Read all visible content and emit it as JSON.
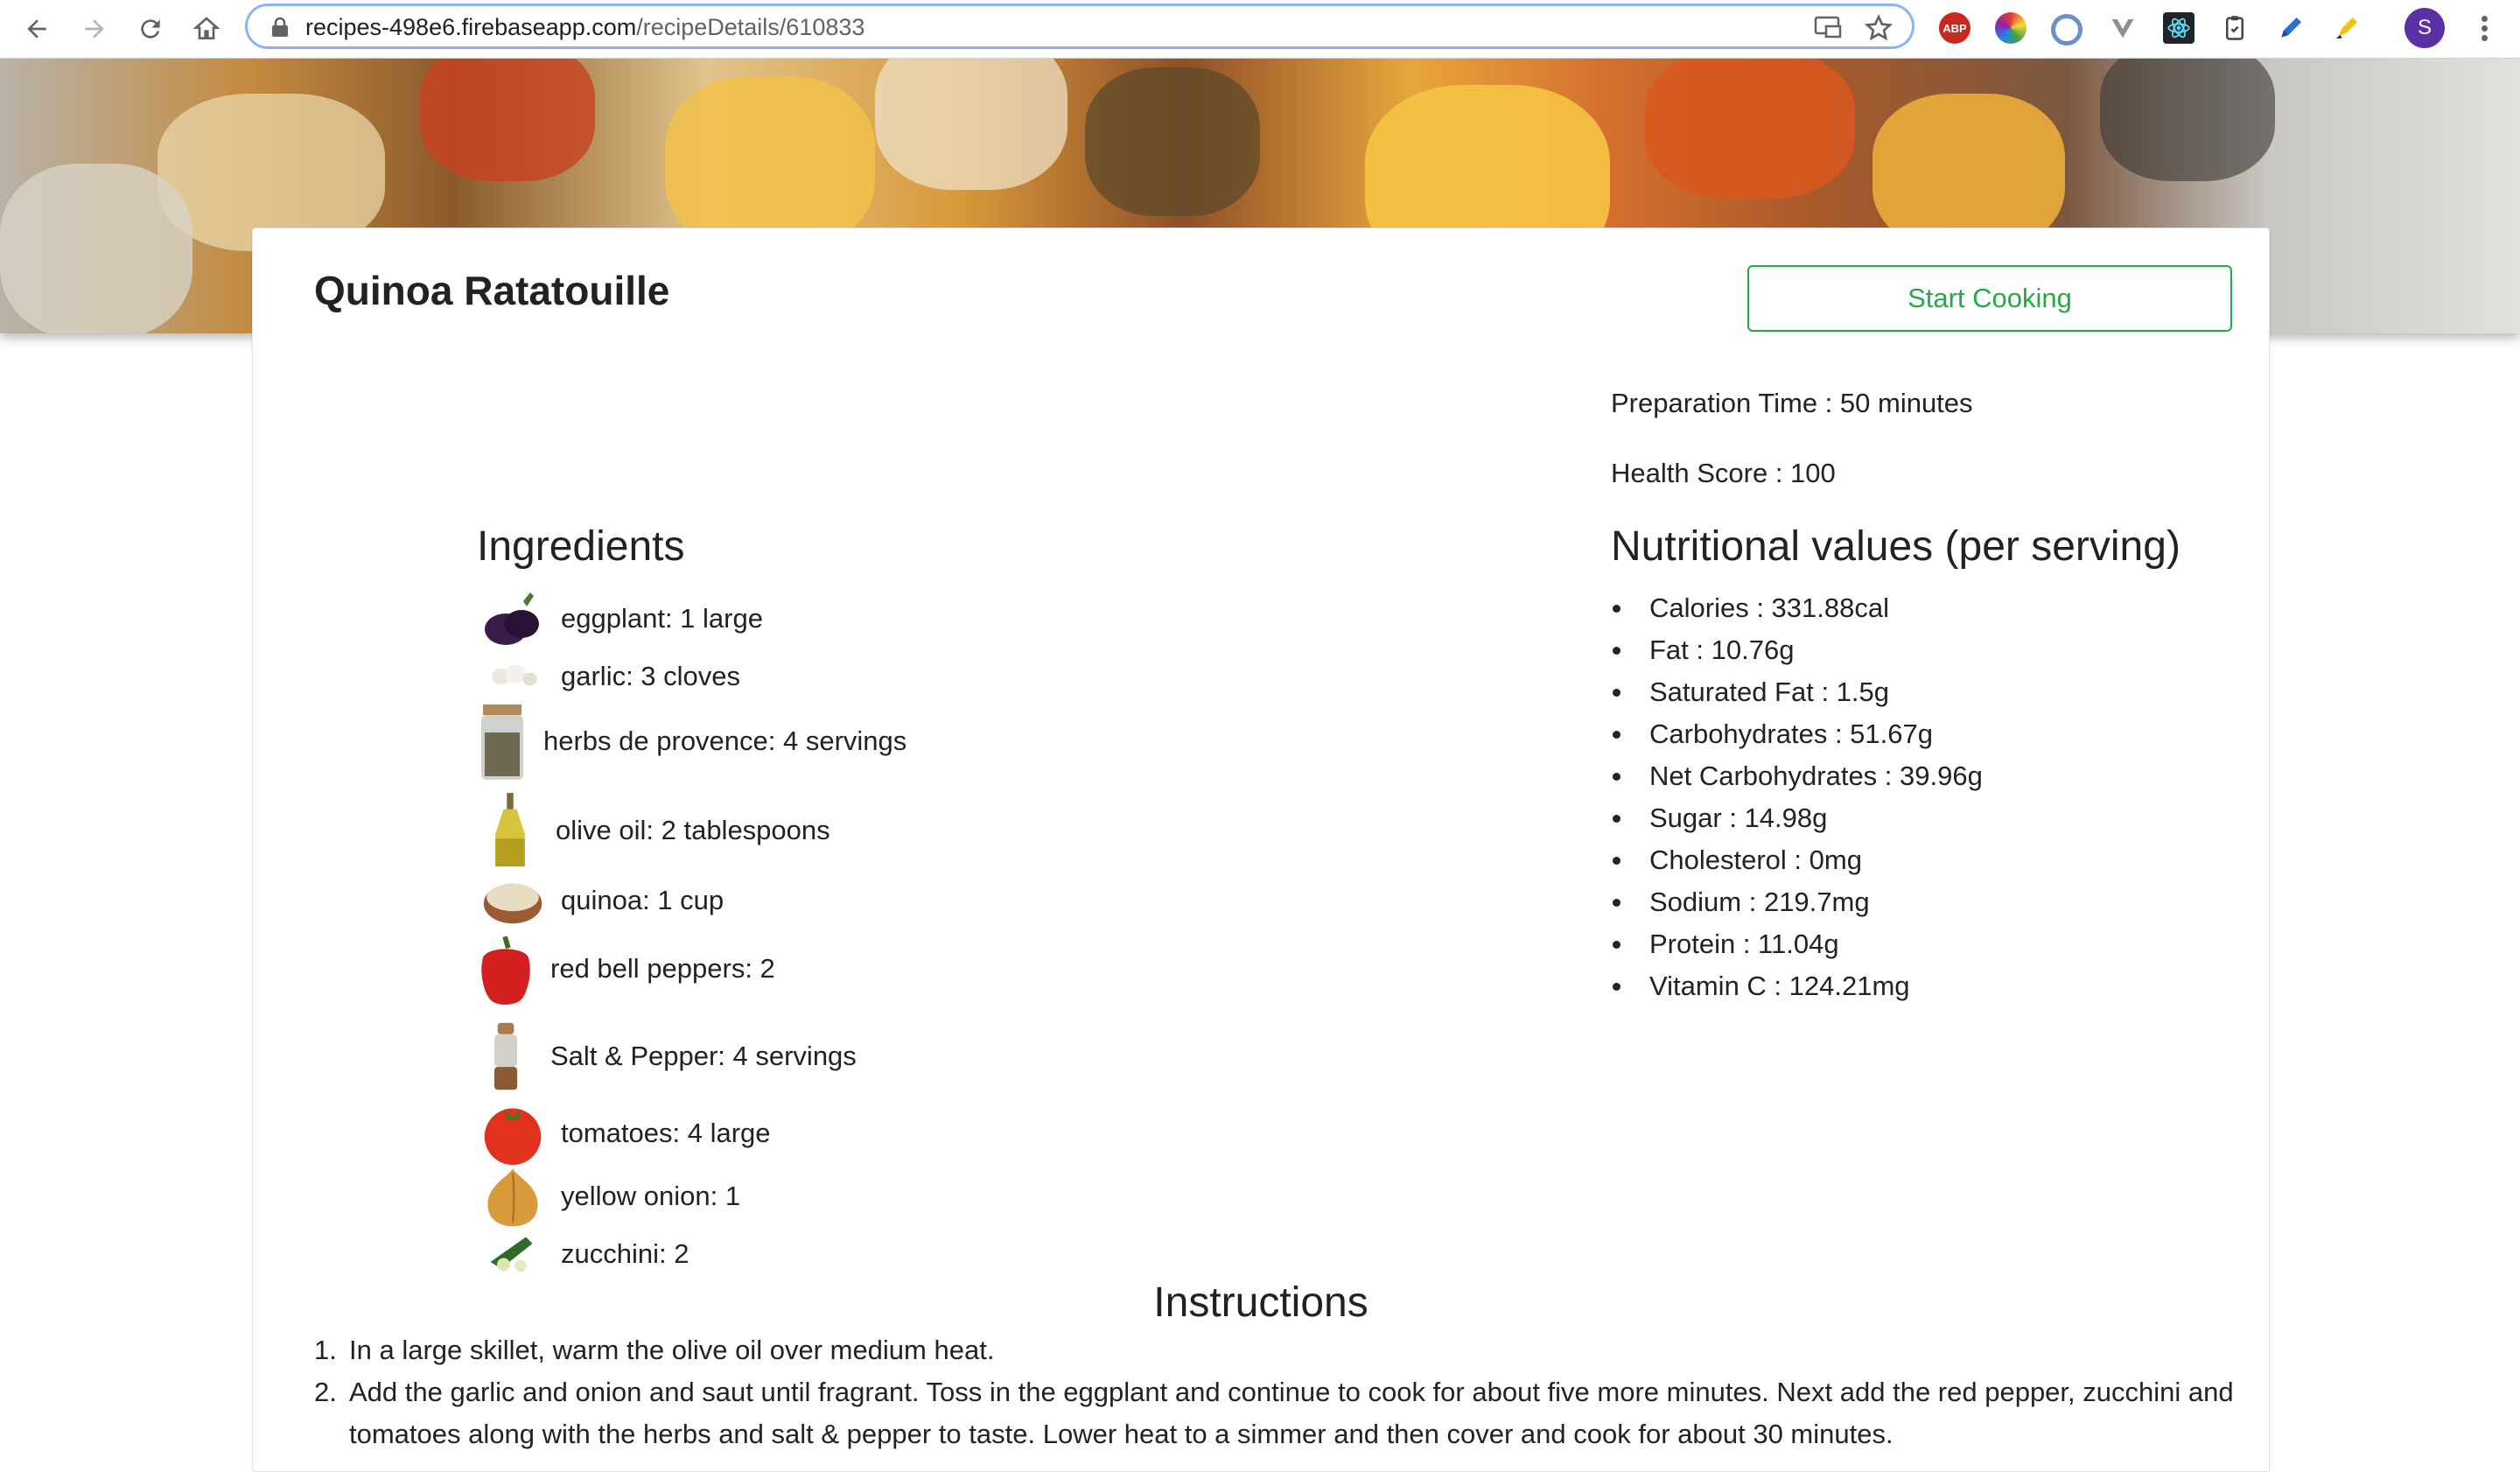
{
  "browser": {
    "url_host": "recipes-498e6.firebaseapp.com",
    "url_path": "/recipeDetails/610833",
    "extensions": [
      "adblock-plus-icon",
      "color-wheel-icon",
      "refresh-circle-icon",
      "vue-devtools-icon",
      "react-devtools-icon",
      "clipboard-icon",
      "pen-icon",
      "highlighter-icon"
    ],
    "abp_label": "ABP",
    "profile_initial": "S"
  },
  "recipe": {
    "title": "Quinoa Ratatouille",
    "start_button": "Start Cooking",
    "prep_time": "Preparation Time : 50 minutes",
    "health_score": "Health Score : 100"
  },
  "ingredients": {
    "heading": "Ingredients",
    "items": [
      {
        "icon": "eggplant-icon",
        "text": "eggplant: 1 large"
      },
      {
        "icon": "garlic-icon",
        "text": "garlic: 3 cloves"
      },
      {
        "icon": "herbs-jar-icon",
        "text": "herbs de provence: 4 servings"
      },
      {
        "icon": "olive-oil-icon",
        "text": "olive oil: 2 tablespoons"
      },
      {
        "icon": "quinoa-icon",
        "text": "quinoa: 1 cup"
      },
      {
        "icon": "red-pepper-icon",
        "text": "red bell peppers: 2"
      },
      {
        "icon": "salt-pepper-icon",
        "text": "Salt & Pepper: 4 servings"
      },
      {
        "icon": "tomato-icon",
        "text": "tomatoes: 4 large"
      },
      {
        "icon": "onion-icon",
        "text": "yellow onion: 1"
      },
      {
        "icon": "zucchini-icon",
        "text": "zucchini: 2"
      }
    ]
  },
  "nutrition": {
    "heading": "Nutritional values (per serving)",
    "items": [
      "Calories : 331.88cal",
      "Fat : 10.76g",
      "Saturated Fat : 1.5g",
      "Carbohydrates : 51.67g",
      "Net Carbohydrates : 39.96g",
      "Sugar : 14.98g",
      "Cholesterol : 0mg",
      "Sodium : 219.7mg",
      "Protein : 11.04g",
      "Vitamin C : 124.21mg"
    ]
  },
  "instructions": {
    "heading": "Instructions",
    "steps": [
      "In a large skillet, warm the olive oil over medium heat.",
      "Add the garlic and onion and saut until fragrant. Toss in the eggplant and continue to cook for about five more minutes. Next add the red pepper, zucchini and tomatoes along with the herbs and salt & pepper to taste. Lower heat to a simmer and then cover and cook for about 30 minutes."
    ]
  }
}
